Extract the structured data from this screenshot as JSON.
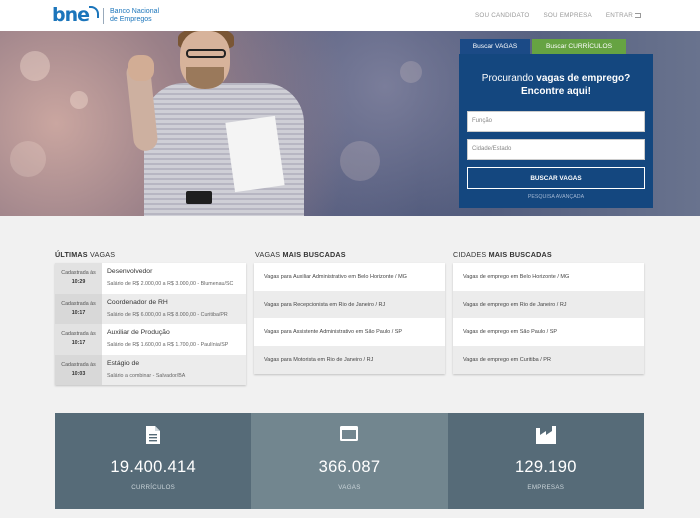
{
  "header": {
    "logo_text": "bne",
    "brand_line1": "Banco Nacional",
    "brand_line2": "de Empregos",
    "nav": {
      "candidato": "SOU CANDIDATO",
      "empresa": "SOU EMPRESA",
      "entrar": "ENTRAR"
    }
  },
  "search": {
    "tab_vagas": "Buscar VAGAS",
    "tab_curriculos": "Buscar CURRÍCULOS",
    "title_pre": "Procurando ",
    "title_bold": "vagas de emprego?",
    "title_line2": "Encontre aqui!",
    "funcao_placeholder": "Função",
    "cidade_placeholder": "Cidade/Estado",
    "button": "BUSCAR VAGAS",
    "advanced": "PESQUISA AVANÇADA"
  },
  "ultimas": {
    "title_bold": "ÚLTIMAS",
    "title_rest": " VAGAS",
    "date_label": "Cadastrada às",
    "jobs": [
      {
        "time": "10:29",
        "title": "Desenvolvedor",
        "sub": "Salário de R$ 2.000,00 a R$ 3.000,00 - Blumenau/SC"
      },
      {
        "time": "10:17",
        "title": "Coordenador de RH",
        "sub": "Salário de R$ 6.000,00 a R$ 8.000,00 - Curitiba/PR"
      },
      {
        "time": "10:17",
        "title": "Auxiliar de Produção",
        "sub": "Salário de R$ 1.600,00 a R$ 1.700,00 - Paulínia/SP"
      },
      {
        "time": "10:03",
        "title": "Estágio de",
        "sub": "Salário a combinar - Salvador/BA"
      }
    ]
  },
  "mais_buscadas": {
    "title_pre": "VAGAS ",
    "title_bold": "MAIS BUSCADAS",
    "items": [
      "Vagas para Auxiliar Administrativo em Belo Horizonte / MG",
      "Vagas para Recepcionista em Rio de Janeiro / RJ",
      "Vagas para Assistente Administrativo em São Paulo / SP",
      "Vagas para Motorista em Rio de Janeiro / RJ"
    ]
  },
  "cidades": {
    "title_pre": "CIDADES ",
    "title_bold": "MAIS BUSCADAS",
    "items": [
      "Vagas de emprego em Belo Horizonte / MG",
      "Vagas de emprego em Rio de Janeiro / RJ",
      "Vagas de emprego em São Paulo / SP",
      "Vagas de emprego em Curitiba / PR"
    ]
  },
  "stats": [
    {
      "value": "19.400.414",
      "label": "CURRÍCULOS",
      "icon": "document-icon"
    },
    {
      "value": "366.087",
      "label": "VAGAS",
      "icon": "browser-window-icon"
    },
    {
      "value": "129.190",
      "label": "EMPRESAS",
      "icon": "factory-icon"
    }
  ],
  "colors": {
    "brand_blue": "#1b75bb",
    "panel_blue": "#14477f",
    "tab_green": "#66a342",
    "stat_dark": "#566b78",
    "stat_light": "#72868f"
  }
}
